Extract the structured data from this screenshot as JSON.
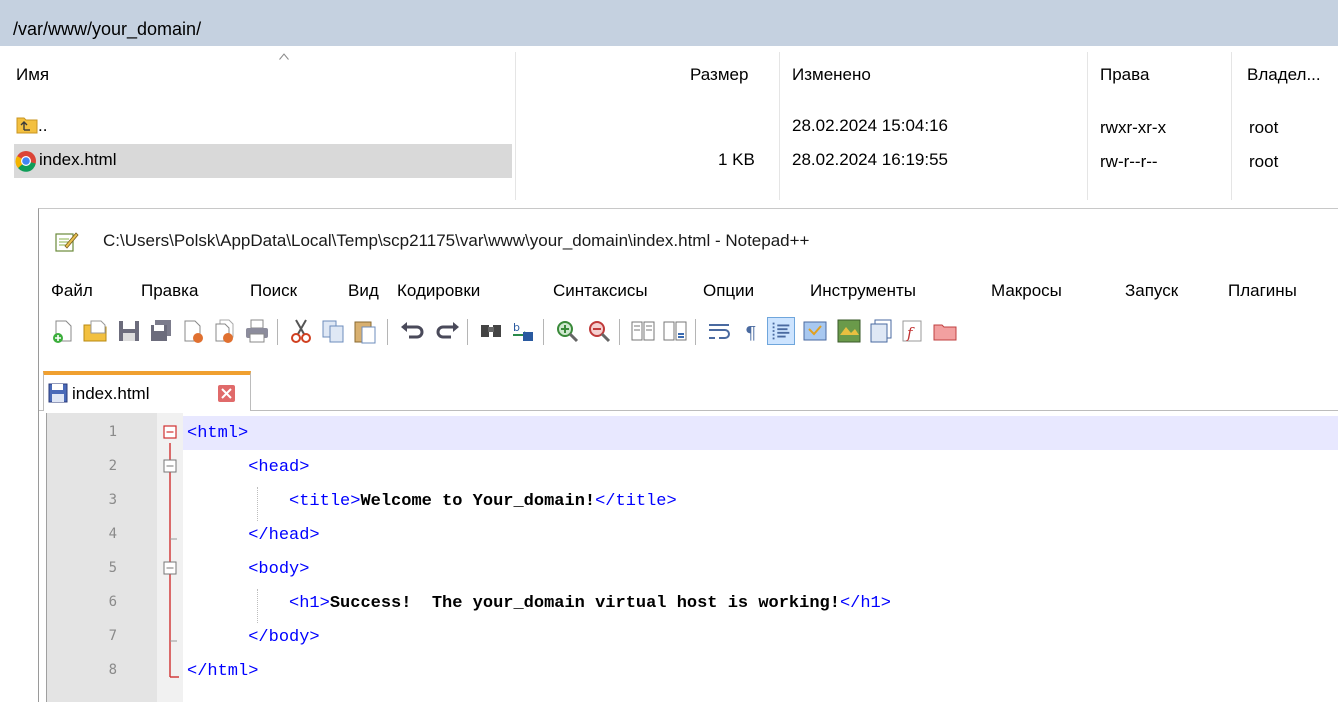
{
  "winscp": {
    "path": "/var/www/your_domain/",
    "columns": {
      "name": "Имя",
      "size": "Размер",
      "modified": "Изменено",
      "rights": "Права",
      "owner": "Владел..."
    },
    "files": [
      {
        "name": "..",
        "size": "",
        "modified": "28.02.2024 15:04:16",
        "rights": "rwxr-xr-x",
        "owner": "root",
        "icon": "parent-folder-icon"
      },
      {
        "name": "index.html",
        "size": "1 KB",
        "modified": "28.02.2024 16:19:55",
        "rights": "rw-r--r--",
        "owner": "root",
        "icon": "chrome-icon",
        "selected": true
      }
    ]
  },
  "notepad": {
    "title": "C:\\Users\\Polsk\\AppData\\Local\\Temp\\scp21175\\var\\www\\your_domain\\index.html - Notepad++",
    "menu": [
      "Файл",
      "Правка",
      "Поиск",
      "Вид",
      "Кодировки",
      "Синтаксисы",
      "Опции",
      "Инструменты",
      "Макросы",
      "Запуск",
      "Плагины"
    ],
    "tab_label": "index.html",
    "line_numbers": [
      "1",
      "2",
      "3",
      "4",
      "5",
      "6",
      "7",
      "8"
    ],
    "code": {
      "l1_tag": "<html>",
      "l2_tag": "<head>",
      "l3_open": "<title>",
      "l3_text": "Welcome to Your_domain!",
      "l3_close": "</title>",
      "l4_tag": "</head>",
      "l5_tag": "<body>",
      "l6_open": "<h1>",
      "l6_text": "Success!  The your_domain virtual host is working!",
      "l6_close": "</h1>",
      "l7_tag": "</body>",
      "l8_tag": "</html>"
    }
  },
  "colors": {
    "path_bar": "#c5d1e0",
    "tag": "#0000ff",
    "fold_line": "#d03030",
    "active_tab_accent": "#f0a030"
  }
}
